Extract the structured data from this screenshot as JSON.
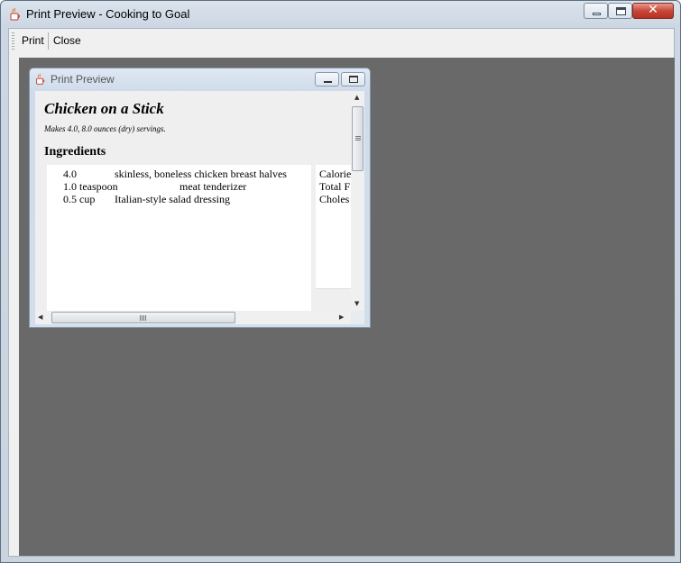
{
  "window": {
    "title": "Print Preview - Cooking to Goal",
    "icon": "java-cup-icon"
  },
  "toolbar": {
    "print_label": "Print",
    "close_label": "Close"
  },
  "inner_frame": {
    "title": "Print Preview",
    "icon": "java-cup-icon"
  },
  "recipe": {
    "name": "Chicken on a Stick",
    "makes": "Makes 4.0, 8.0 ounces (dry) servings.",
    "ingredients_heading": "Ingredients",
    "ingredients": [
      {
        "qty": "4.0",
        "item": "skinless, boneless chicken breast halves"
      },
      {
        "qty": "1.0 teaspoon",
        "item": "meat tenderizer"
      },
      {
        "qty": "0.5 cup",
        "item": "Italian-style salad dressing"
      }
    ],
    "nutrition": [
      "Calorie",
      "Total F",
      "Choles"
    ]
  },
  "colors": {
    "canvas": "#696969",
    "close_button": "#c9463a"
  }
}
